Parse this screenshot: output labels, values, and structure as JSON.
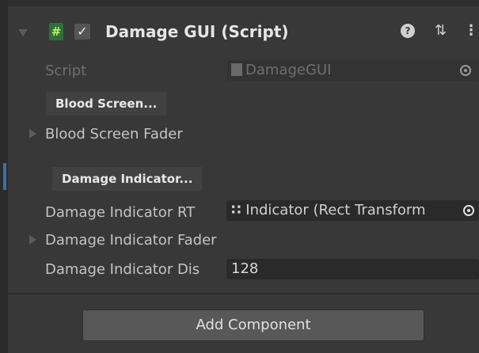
{
  "component": {
    "title": "Damage GUI (Script)",
    "enabled_check": "✓",
    "script_icon": "#",
    "help_glyph": "?",
    "preset_glyph": "⇅",
    "menu_glyph": "⋮"
  },
  "fields": {
    "script_label": "Script",
    "script_value": "DamageGUI",
    "blood_screen_button": "Blood Screen...",
    "blood_screen_fader": "Blood Screen Fader",
    "damage_indicator_button": "Damage Indicator...",
    "damage_indicator_rt_label": "Damage Indicator RT",
    "damage_indicator_rt_value": "Indicator (Rect Transform",
    "damage_indicator_fader": "Damage Indicator Fader",
    "damage_indicator_dis_label": "Damage Indicator Dis",
    "damage_indicator_dis_value": "128"
  },
  "footer": {
    "add_component": "Add Component"
  },
  "icons": [
    "chevron-down-icon",
    "script-icon",
    "checkbox-icon",
    "help-icon",
    "preset-icon",
    "menu-icon",
    "object-picker-icon",
    "rect-transform-icon"
  ]
}
